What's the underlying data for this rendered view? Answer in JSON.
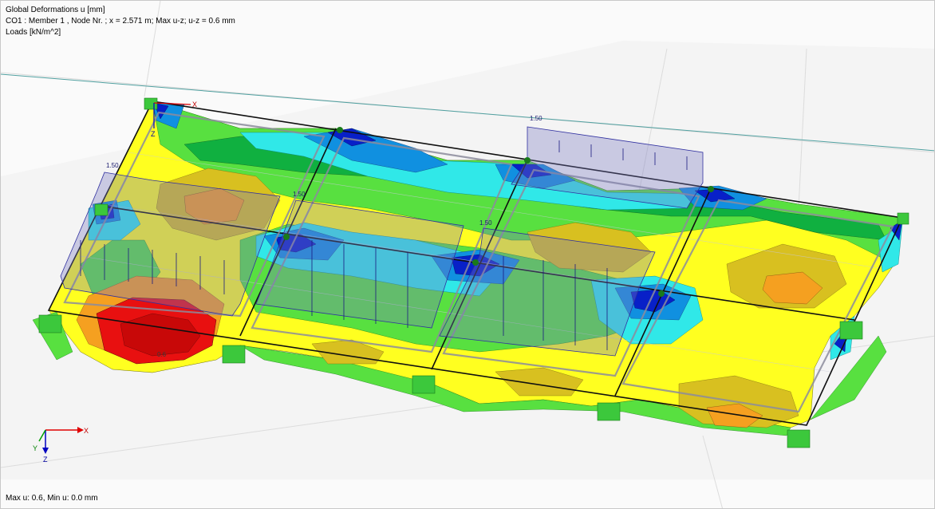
{
  "header": {
    "title": "Global Deformations u [mm]",
    "subtitle": "CO1 : Member 1 , Node Nr. ; x = 2.571 m; Max u-z; u-z = 0.6 mm",
    "loads": "Loads [kN/m^2]"
  },
  "footer": {
    "summary": "Max u: 0.6, Min u: 0.0 mm"
  },
  "load_labels": {
    "l1": "1.50",
    "l2": "1.50",
    "l3": "1.50",
    "l4": "1.50"
  },
  "result_label": "0.6",
  "axes": {
    "x": "X",
    "y": "Y",
    "z": "Z",
    "local_x": "X",
    "local_z": "Z"
  },
  "colors": {
    "red": "#e81010",
    "orange": "#f5a020",
    "ochre": "#d8c020",
    "yellow": "#ffff20",
    "green_light": "#58e040",
    "green": "#10b040",
    "cyan": "#30e8e8",
    "blue_light": "#1090e0",
    "blue": "#0820c8",
    "load_box": "#8080c0",
    "support": "#3cc83c"
  }
}
